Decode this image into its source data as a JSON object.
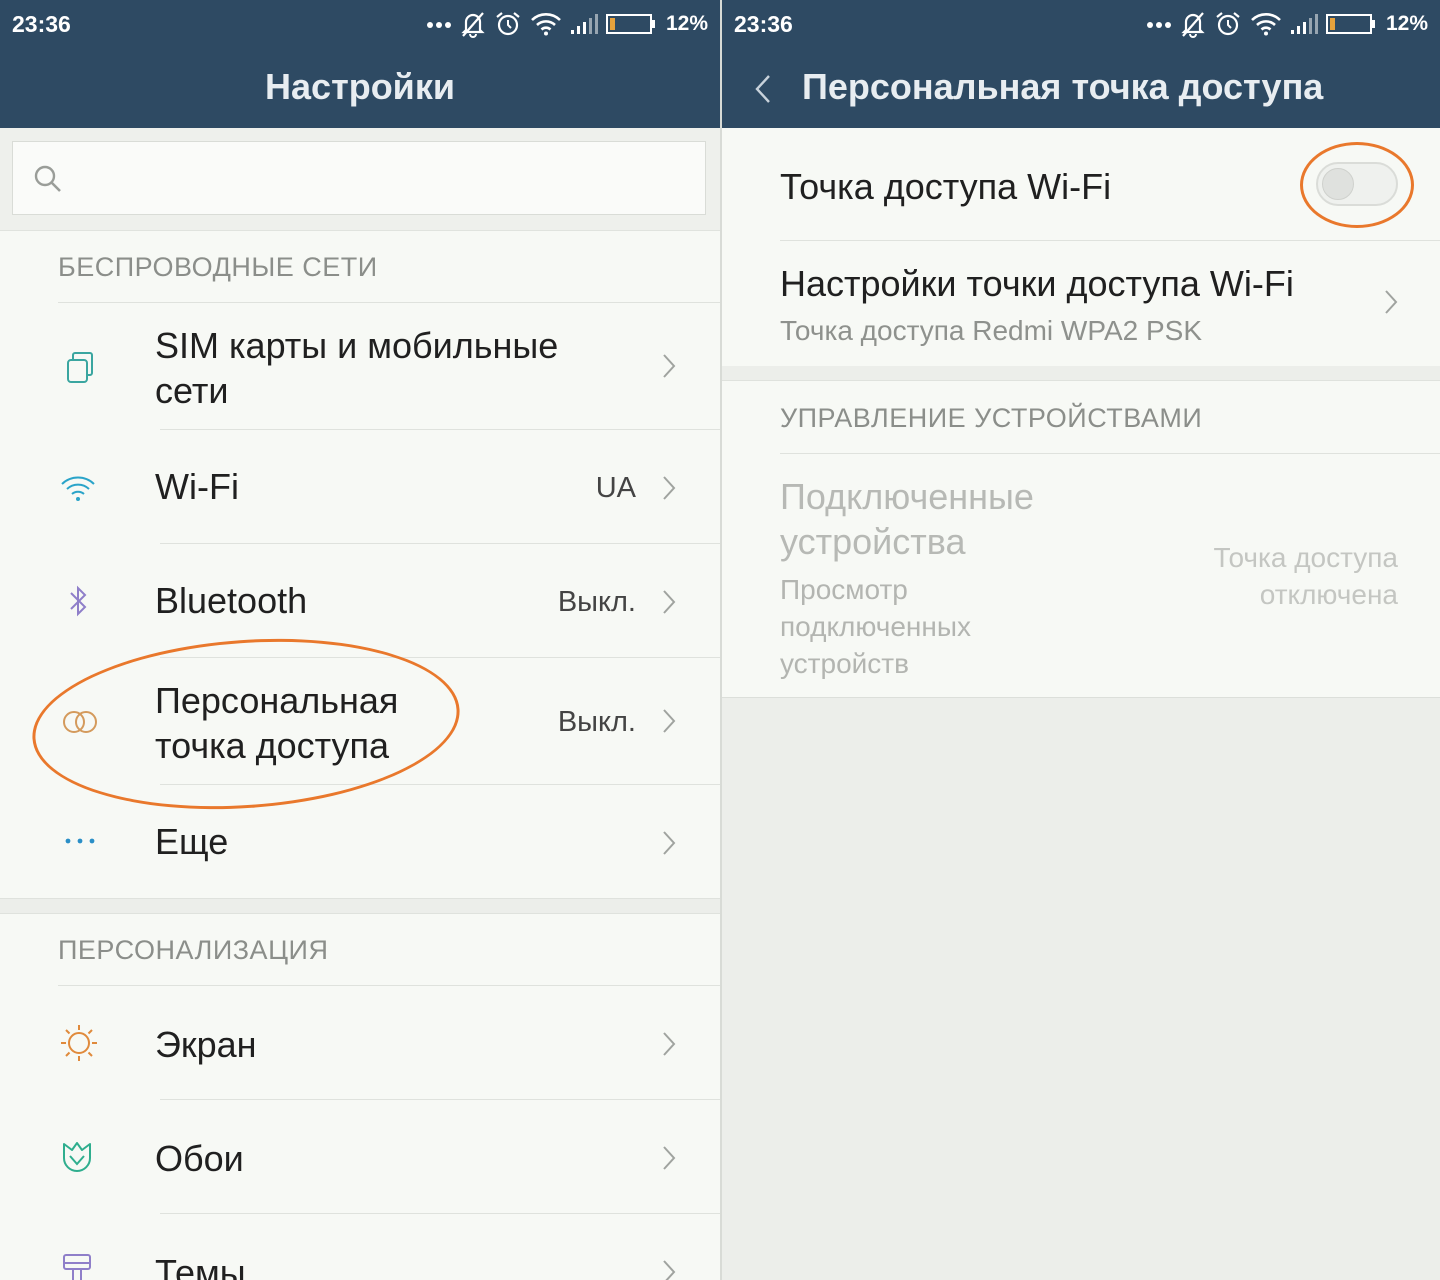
{
  "left": {
    "status": {
      "time": "23:36",
      "battery": "12%"
    },
    "header": {
      "title": "Настройки"
    },
    "search": {
      "placeholder": ""
    },
    "sections": {
      "wireless": "БЕСПРОВОДНЫЕ СЕТИ",
      "personalization": "ПЕРСОНАЛИЗАЦИЯ"
    },
    "items": {
      "sim": {
        "label": "SIM карты и мобильные сети",
        "line1": "SIM карты и мобильные",
        "line2": "сети"
      },
      "wifi": {
        "label": "Wi-Fi",
        "value": "UA"
      },
      "bluetooth": {
        "label": "Bluetooth",
        "value": "Выкл."
      },
      "hotspot": {
        "line1": "Персональная",
        "line2": "точка доступа",
        "value": "Выкл."
      },
      "more": {
        "label": "Еще"
      },
      "screen": {
        "label": "Экран"
      },
      "wallpaper": {
        "label": "Обои"
      },
      "themes": {
        "label": "Темы"
      }
    }
  },
  "right": {
    "status": {
      "time": "23:36",
      "battery": "12%"
    },
    "header": {
      "title": "Персональная точка доступа"
    },
    "hotspot_toggle": {
      "label": "Точка доступа Wi-Fi",
      "state": "off"
    },
    "hotspot_settings": {
      "label": "Настройки точки доступа Wi-Fi",
      "sub": "Точка доступа Redmi WPA2 PSK"
    },
    "device_section": "УПРАВЛЕНИЕ УСТРОЙСТВАМИ",
    "connected": {
      "title_line1": "Подключенные",
      "title_line2": "устройства",
      "sub_line1": "Просмотр",
      "sub_line2": "подключенных",
      "sub_line3": "устройств",
      "status_line1": "Точка доступа",
      "status_line2": "отключена"
    }
  },
  "colors": {
    "header_bg": "#2e4a63",
    "highlight": "#e9782c",
    "accent_teal": "#3aa6a0"
  }
}
